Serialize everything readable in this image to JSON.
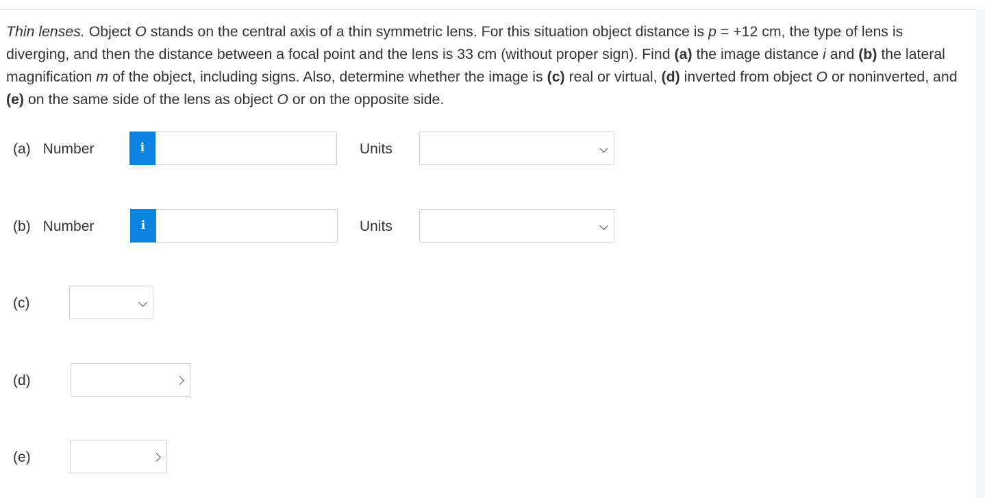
{
  "question": {
    "intro_italic": "Thin lenses.",
    "t1": " Object ",
    "obj1": "O",
    "t2": " stands on the central axis of a thin symmetric lens. For this situation object distance is ",
    "p_var": "p",
    "t3": " = +12 cm, the type of lens is diverging, and then the distance between a focal point and the lens is 33 cm (without proper sign). Find ",
    "a_tag": "(a)",
    "t4": " the image distance ",
    "i_var": "i",
    "t5": " and ",
    "b_tag": "(b)",
    "t6": " the lateral magnification ",
    "m_var": "m",
    "t7": " of the object, including signs. Also, determine whether the image is ",
    "c_tag": "(c)",
    "t8": " real or virtual, ",
    "d_tag": "(d)",
    "t9": " inverted from object ",
    "obj2": "O",
    "t10": " or noninverted, and ",
    "e_tag": "(e)",
    "t11": " on the same side of the lens as object ",
    "obj3": "O",
    "t12": " or on the opposite side."
  },
  "parts": {
    "a": {
      "letter": "(a)",
      "word": "Number",
      "info": "i",
      "value": "",
      "units_label": "Units",
      "units_value": ""
    },
    "b": {
      "letter": "(b)",
      "word": "Number",
      "info": "i",
      "value": "",
      "units_label": "Units",
      "units_value": ""
    },
    "c": {
      "letter": "(c)",
      "value": ""
    },
    "d": {
      "letter": "(d)",
      "value": ""
    },
    "e": {
      "letter": "(e)",
      "value": ""
    }
  },
  "colors": {
    "info_button": "#0a84e0",
    "border": "#cfcfcf",
    "text": "#333333"
  }
}
